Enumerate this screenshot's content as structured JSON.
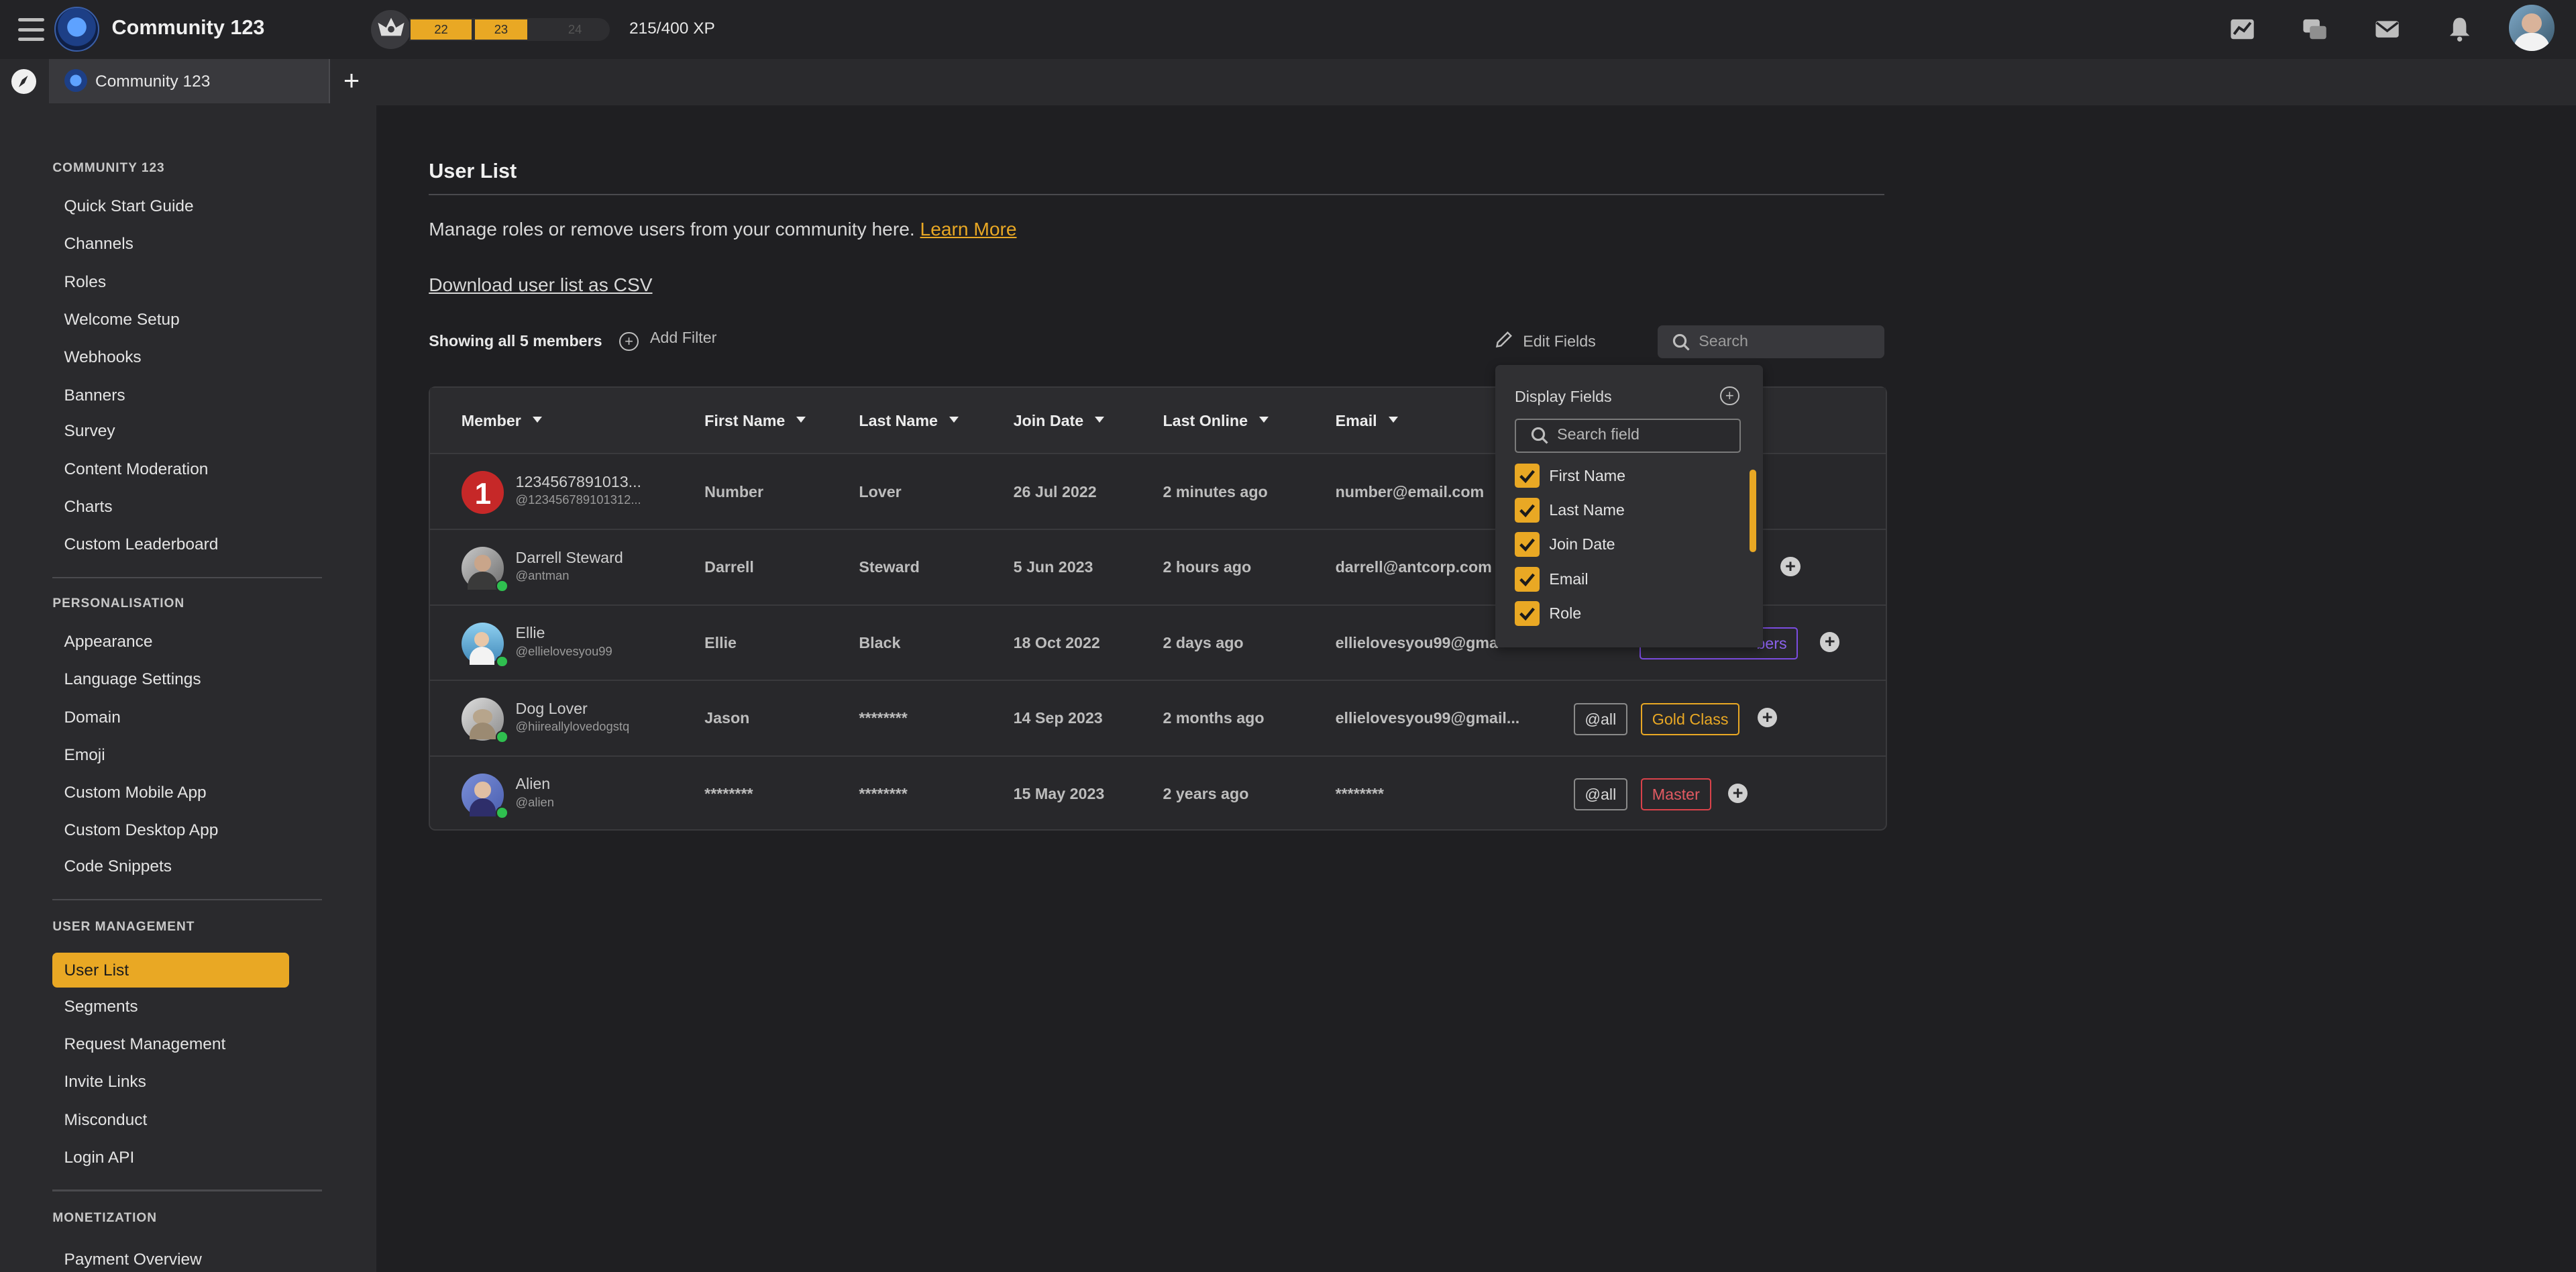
{
  "community": {
    "name": "Community 123"
  },
  "xp": {
    "levels": [
      "22",
      "23",
      "24"
    ],
    "text": "215/400 XP",
    "current_level_progress": 0.54
  },
  "tab": {
    "label": "Community 123"
  },
  "sidebar": {
    "section_community": "COMMUNITY 123",
    "community_items": [
      "Quick Start Guide",
      "Channels",
      "Roles",
      "Welcome Setup",
      "Webhooks",
      "Banners",
      "Survey",
      "Content Moderation",
      "Charts",
      "Custom Leaderboard"
    ],
    "section_personalisation": "PERSONALISATION",
    "personalisation_items": [
      "Appearance",
      "Language Settings",
      "Domain",
      "Emoji",
      "Custom Mobile App",
      "Custom Desktop App",
      "Code Snippets"
    ],
    "section_user_management": "USER MANAGEMENT",
    "user_management_items": [
      "User List",
      "Segments",
      "Request Management",
      "Invite Links",
      "Misconduct",
      "Login API"
    ],
    "section_monetization": "MONETIZATION",
    "monetization_items": [
      "Payment Overview"
    ]
  },
  "main": {
    "title": "User List",
    "description": "Manage roles or remove users from your community here.",
    "learn_more": "Learn More",
    "download_csv": "Download user list as CSV",
    "showing": "Showing all 5 members",
    "add_filter": "Add Filter",
    "edit_fields": "Edit Fields",
    "search_placeholder": "Search"
  },
  "table": {
    "headers": [
      "Member",
      "First Name",
      "Last Name",
      "Join Date",
      "Last Online",
      "Email"
    ],
    "rows": [
      {
        "name": "1234567891013...",
        "handle": "@123456789101312...",
        "first": "Number",
        "last": "Lover",
        "join": "26 Jul 2022",
        "online": "2 minutes ago",
        "email": "number@email.com",
        "tags": []
      },
      {
        "name": "Darrell Steward",
        "handle": "@antman",
        "first": "Darrell",
        "last": "Steward",
        "join": "5 Jun 2023",
        "online": "2 hours ago",
        "email": "darrell@antcorp.com",
        "tags": []
      },
      {
        "name": "Ellie",
        "handle": "@ellielovesyou99",
        "first": "Ellie",
        "last": "Black",
        "join": "18 Oct 2022",
        "online": "2 days ago",
        "email": "ellielovesyou99@gma",
        "tags": [
          "bers"
        ]
      },
      {
        "name": "Dog Lover",
        "handle": "@hiireallylovedogstq",
        "first": "Jason",
        "last": "********",
        "join": "14 Sep 2023",
        "online": "2 months ago",
        "email": "ellielovesyou99@gmail...",
        "tags": [
          "@all",
          "Gold Class"
        ]
      },
      {
        "name": "Alien",
        "handle": "@alien",
        "first": "********",
        "last": "********",
        "join": "15 May 2023",
        "online": "2 years ago",
        "email": "********",
        "tags": [
          "@all",
          "Master"
        ]
      }
    ]
  },
  "dropdown": {
    "title": "Display Fields",
    "search_placeholder": "Search field",
    "fields": [
      "First Name",
      "Last Name",
      "Join Date",
      "Email",
      "Role"
    ]
  },
  "colors": {
    "accent": "#e9a824",
    "background": "#1f1f22",
    "sidebar": "#2a2a2d",
    "online": "#2fbf4f",
    "master": "#d9424a",
    "members": "#7b4ce0"
  },
  "icons": {
    "menu": "hamburger-icon",
    "stats": "chart-icon",
    "chat": "chat-icon",
    "mail": "mail-icon",
    "notifications": "bell-icon",
    "discover": "compass-icon"
  }
}
